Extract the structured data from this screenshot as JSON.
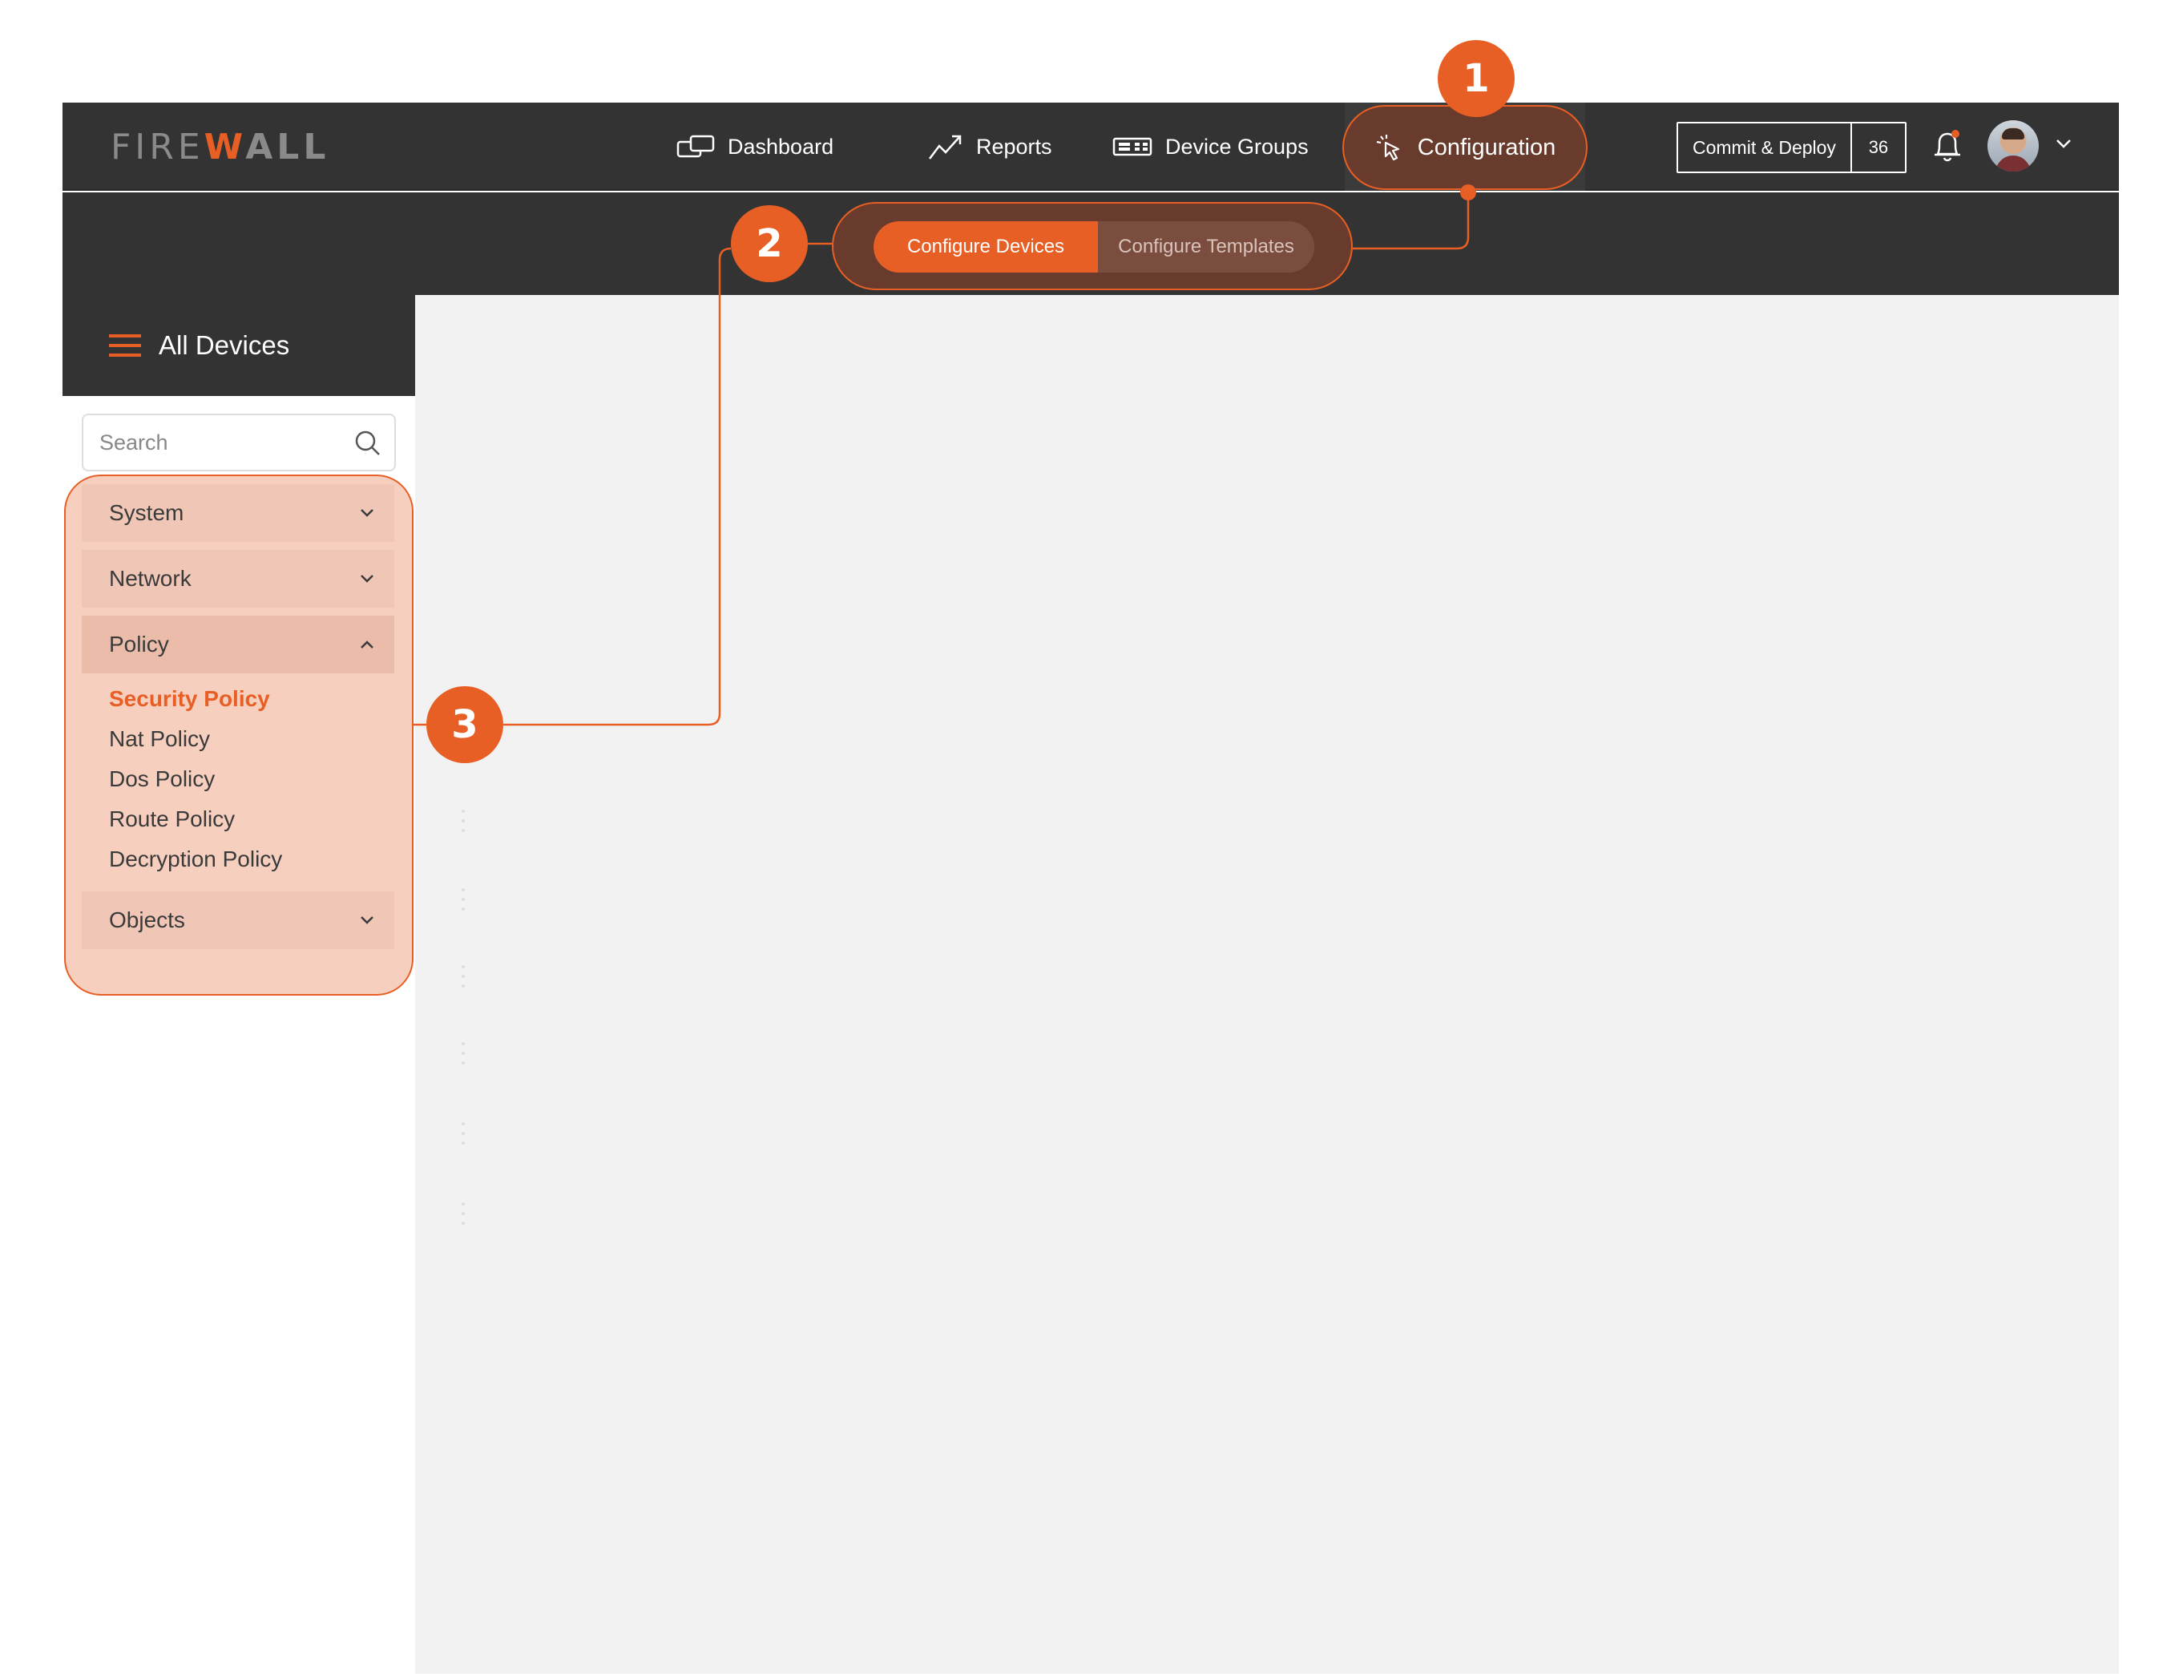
{
  "logo": {
    "fire": "FIRE",
    "w": "W",
    "all": "ALL"
  },
  "nav": {
    "dashboard": "Dashboard",
    "reports": "Reports",
    "device_groups": "Device Groups",
    "configuration": "Configuration"
  },
  "header_actions": {
    "commit_label": "Commit & Deploy",
    "commit_count": "36"
  },
  "subtabs": {
    "configure_devices": "Configure Devices",
    "configure_templates": "Configure Templates"
  },
  "sidebar": {
    "title": "All Devices",
    "search_placeholder": "Search",
    "groups": [
      {
        "label": "System",
        "expanded": false
      },
      {
        "label": "Network",
        "expanded": false
      },
      {
        "label": "Policy",
        "expanded": true
      },
      {
        "label": "Objects",
        "expanded": false
      }
    ],
    "policy_items": [
      {
        "label": "Security Policy",
        "active": true
      },
      {
        "label": "Nat Policy",
        "active": false
      },
      {
        "label": "Dos Policy",
        "active": false
      },
      {
        "label": "Route Policy",
        "active": false
      },
      {
        "label": "Decryption Policy",
        "active": false
      }
    ]
  },
  "annotations": {
    "one": "1",
    "two": "2",
    "three": "3"
  },
  "colors": {
    "accent": "#e85f25",
    "topbar": "#333333",
    "highlight_fill": "#f7cfbf",
    "content_bg": "#f2f2f2"
  },
  "icons": {
    "dashboard": "dashboard-icon",
    "reports": "trend-icon",
    "device_groups": "device-groups-icon",
    "configuration": "pointer-click-icon",
    "bell": "bell-icon",
    "menu": "hamburger-icon",
    "search": "search-icon"
  }
}
